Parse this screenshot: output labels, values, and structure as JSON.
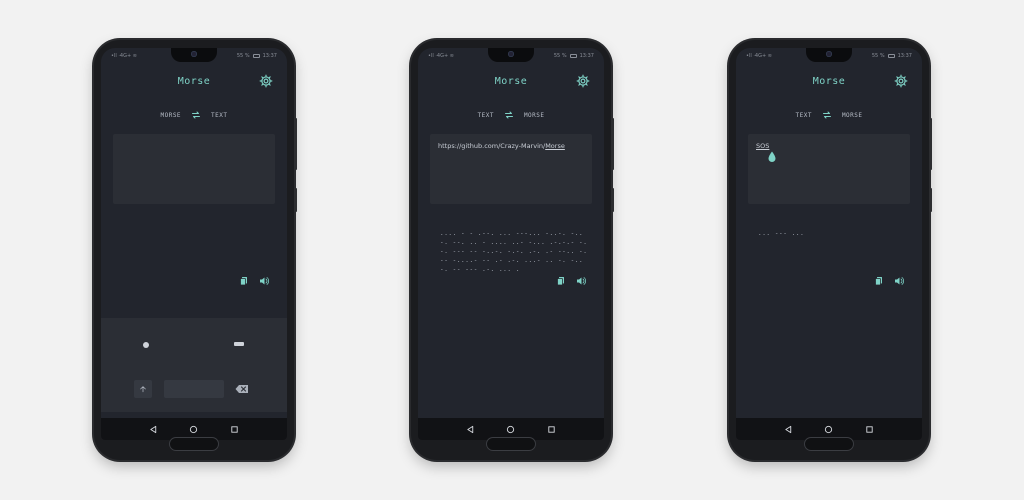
{
  "colors": {
    "accent": "#7fd3c7",
    "background": "#22252d",
    "surface": "#2b2e35"
  },
  "status": {
    "carrier": "•ll ·4G+ ≋",
    "battery": "55 %",
    "time": "13:37"
  },
  "phones": [
    {
      "title": "Morse",
      "mode_left": "MORSE",
      "mode_right": "TEXT",
      "input_text": "",
      "input_link": "",
      "output": ""
    },
    {
      "title": "Morse",
      "mode_left": "TEXT",
      "mode_right": "MORSE",
      "input_text": "https://github.com/Crazy-Marvin/",
      "input_link": "Morse",
      "output": ".... - - .--. ... ---... -..-. -..-. --. .. - .... ..- -... .-.-.- -.-. --- -- -..-. -.-. .-. .- --.. -.-- -....- -- .- .-. ...- .. -. -..-. -- --- .-. ... ."
    },
    {
      "title": "Morse",
      "mode_left": "TEXT",
      "mode_right": "MORSE",
      "input_text": "",
      "input_link": "SOS",
      "output": "... --- ..."
    }
  ],
  "icons": {
    "settings": "gear-icon",
    "swap": "swap-arrows-icon",
    "copy": "copy-icon",
    "speaker": "speaker-icon",
    "shift": "arrow-up-icon",
    "backspace": "backspace-icon",
    "nav_back": "triangle-back-icon",
    "nav_home": "circle-home-icon",
    "nav_recents": "square-recents-icon"
  }
}
